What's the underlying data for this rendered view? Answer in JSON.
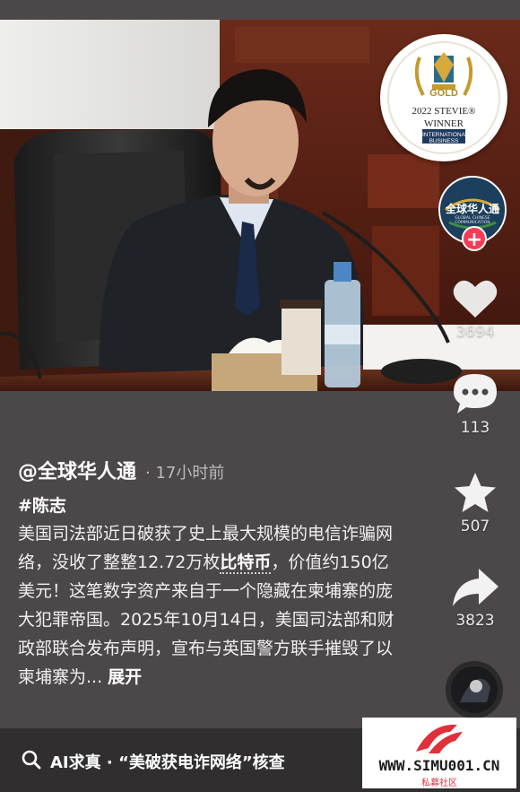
{
  "video": {
    "award": {
      "line_gold": "GOLD",
      "line_year": "2022 STEVIE®",
      "line_winner": "WINNER",
      "line_awards": "INTERNATIONAL BUSINESS AWARDS"
    },
    "channel_logo_text": "全球华人通",
    "channel_logo_sub": "GLOBAL CHINESE COMMUNICATION"
  },
  "actions": {
    "likes": "3694",
    "comments": "113",
    "favorites": "507",
    "shares": "3823"
  },
  "caption": {
    "author": "@全球华人通",
    "time_ago": "· 17小时前",
    "hashtag": "#陈志",
    "text_part1": "美国司法部近日破获了史上最大规模的电信诈骗网络，没收了整整12.72万枚",
    "keyword": "比特币",
    "text_part2": "，价值约150亿美元！这笔数字资产来自于一个隐藏在柬埔寨的庞大犯罪帝国。2025年10月14日，美国司法部和财政部联合发布声明，宣布与英国警方联手摧毁了以柬埔寨为... ",
    "expand": "展开"
  },
  "ai_search": {
    "text": "AI求真 · “美破获电诈网络”核查"
  },
  "watermark": {
    "url": "WWW.SIMU001.CN",
    "label": "私募社区"
  },
  "colors": {
    "background": "#4c4849",
    "follow": "#f63b55",
    "watermark_red": "#e0303a"
  }
}
